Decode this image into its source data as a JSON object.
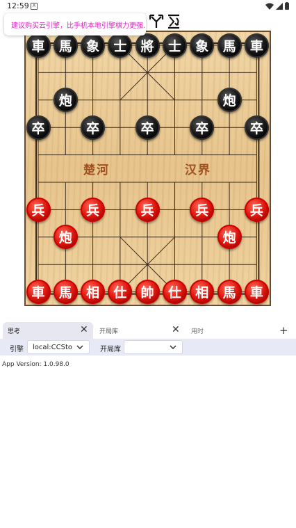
{
  "status_bar": {
    "time": "12:59",
    "notif": "A"
  },
  "toast": {
    "text": "建议购买云引擎，比手机本地引擎棋力更强."
  },
  "toolbar_icons": [
    "flip-arrows-icon",
    "swap-sides-icon"
  ],
  "board": {
    "river_left": "楚河",
    "river_right": "汉界",
    "pieces": [
      {
        "side": "black",
        "label": "車",
        "file": 0,
        "rank": 0
      },
      {
        "side": "black",
        "label": "馬",
        "file": 1,
        "rank": 0
      },
      {
        "side": "black",
        "label": "象",
        "file": 2,
        "rank": 0
      },
      {
        "side": "black",
        "label": "士",
        "file": 3,
        "rank": 0
      },
      {
        "side": "black",
        "label": "將",
        "file": 4,
        "rank": 0
      },
      {
        "side": "black",
        "label": "士",
        "file": 5,
        "rank": 0
      },
      {
        "side": "black",
        "label": "象",
        "file": 6,
        "rank": 0
      },
      {
        "side": "black",
        "label": "馬",
        "file": 7,
        "rank": 0
      },
      {
        "side": "black",
        "label": "車",
        "file": 8,
        "rank": 0
      },
      {
        "side": "black",
        "label": "炮",
        "file": 1,
        "rank": 2
      },
      {
        "side": "black",
        "label": "炮",
        "file": 7,
        "rank": 2
      },
      {
        "side": "black",
        "label": "卒",
        "file": 0,
        "rank": 3
      },
      {
        "side": "black",
        "label": "卒",
        "file": 2,
        "rank": 3
      },
      {
        "side": "black",
        "label": "卒",
        "file": 4,
        "rank": 3
      },
      {
        "side": "black",
        "label": "卒",
        "file": 6,
        "rank": 3
      },
      {
        "side": "black",
        "label": "卒",
        "file": 8,
        "rank": 3
      },
      {
        "side": "red",
        "label": "兵",
        "file": 0,
        "rank": 6
      },
      {
        "side": "red",
        "label": "兵",
        "file": 2,
        "rank": 6
      },
      {
        "side": "red",
        "label": "兵",
        "file": 4,
        "rank": 6
      },
      {
        "side": "red",
        "label": "兵",
        "file": 6,
        "rank": 6
      },
      {
        "side": "red",
        "label": "兵",
        "file": 8,
        "rank": 6
      },
      {
        "side": "red",
        "label": "炮",
        "file": 1,
        "rank": 7
      },
      {
        "side": "red",
        "label": "炮",
        "file": 7,
        "rank": 7
      },
      {
        "side": "red",
        "label": "車",
        "file": 0,
        "rank": 9
      },
      {
        "side": "red",
        "label": "馬",
        "file": 1,
        "rank": 9
      },
      {
        "side": "red",
        "label": "相",
        "file": 2,
        "rank": 9
      },
      {
        "side": "red",
        "label": "仕",
        "file": 3,
        "rank": 9
      },
      {
        "side": "red",
        "label": "帥",
        "file": 4,
        "rank": 9
      },
      {
        "side": "red",
        "label": "仕",
        "file": 5,
        "rank": 9
      },
      {
        "side": "red",
        "label": "相",
        "file": 6,
        "rank": 9
      },
      {
        "side": "red",
        "label": "馬",
        "file": 7,
        "rank": 9
      },
      {
        "side": "red",
        "label": "車",
        "file": 8,
        "rank": 9
      }
    ]
  },
  "tabs": [
    {
      "label": "思考",
      "active": true
    },
    {
      "label": "开局库",
      "active": false
    },
    {
      "label": "用时",
      "active": false
    }
  ],
  "toolbar": {
    "engine_label": "引擎",
    "engine_value": "local:CCSto",
    "book_label": "开局库",
    "book_value": ""
  },
  "version": "App Version: 1.0.98.0",
  "colors": {
    "toast_text": "#e020c0",
    "toolbar_bg": "#e7e9f6",
    "river_text": "#a05020"
  }
}
